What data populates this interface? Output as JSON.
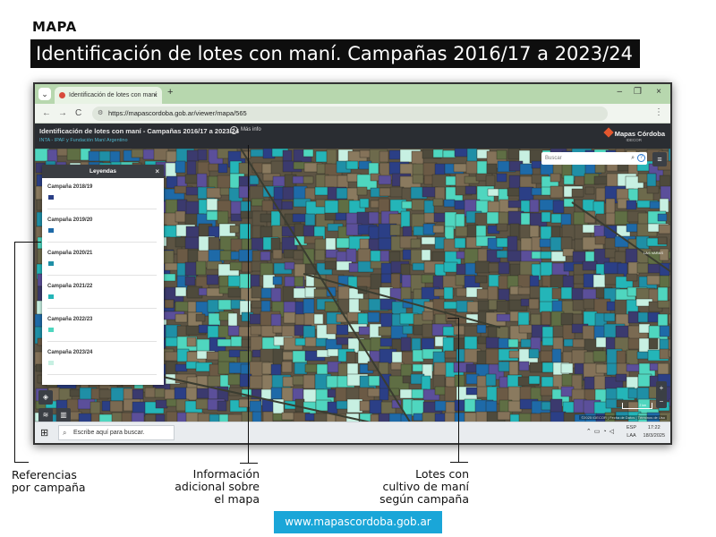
{
  "header": {
    "section": "MAPA",
    "title": "Identificación de lotes con maní. Campañas 2016/17 a 2023/24"
  },
  "browser": {
    "tab_title": "Identificación de lotes con maní",
    "tab_close": "×",
    "new_tab": "+",
    "url": "https://mapascordoba.gob.ar/viewer/mapa/565",
    "window_controls": [
      "–",
      "❐",
      "×"
    ],
    "nav": [
      "←",
      "→",
      "C"
    ]
  },
  "app": {
    "title": "Identificación de lotes con maní - Campañas 2016/17 a 2023/24",
    "subtitle": "INTA - IPAF y Fundación Maní Argentino",
    "info_label": "Más info",
    "brand": "Mapas Córdoba",
    "brand_sub": "IDECOR",
    "search_placeholder": "Buscar",
    "attribution": "©2025 IDECOR | Fecha de Datos | Términos de Uso",
    "scale": "2 km",
    "place": "LAS VARAS",
    "colors": {
      "c2018": "#2b3f86",
      "c2019": "#1e6aa8",
      "c2020": "#1f8fa6",
      "c2021": "#24b5b8",
      "c2022": "#4fd6bf",
      "c2023": "#c7f0e2"
    }
  },
  "legend": {
    "title": "Leyendas",
    "close": "×",
    "items": [
      {
        "label": "Campaña 2018/19",
        "color": "#2b3f86"
      },
      {
        "label": "Campaña 2019/20",
        "color": "#1e6aa8"
      },
      {
        "label": "Campaña 2020/21",
        "color": "#1f8fa6"
      },
      {
        "label": "Campaña 2021/22",
        "color": "#24b5b8"
      },
      {
        "label": "Campaña 2022/23",
        "color": "#4fd6bf"
      },
      {
        "label": "Campaña 2023/24",
        "color": "#c7f0e2"
      }
    ]
  },
  "taskbar": {
    "search_text": "Escribe aquí para buscar.",
    "lang": "ESP",
    "lang_sub": "LAA",
    "time": "17:22",
    "date": "18/3/2025"
  },
  "callouts": {
    "references": [
      "Referencias",
      "por campaña"
    ],
    "info": [
      "Información",
      "adicional sobre",
      "el mapa"
    ],
    "lots": [
      "Lotes con",
      "cultivo de maní",
      "según campaña"
    ]
  },
  "footer": {
    "url": "www.mapascordoba.gob.ar"
  }
}
